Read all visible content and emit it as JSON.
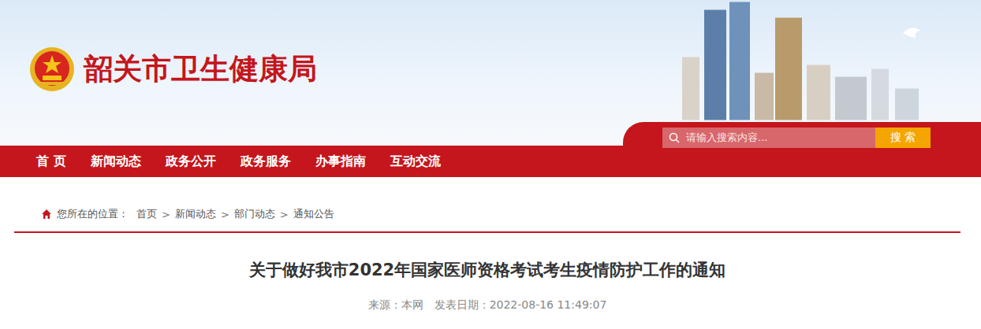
{
  "site": {
    "title": "韶关市卫生健康局"
  },
  "nav": [
    {
      "label": "首 页",
      "selected": false
    },
    {
      "label": "新闻动态",
      "selected": false
    },
    {
      "label": "政务公开",
      "selected": false
    },
    {
      "label": "政务服务",
      "selected": false
    },
    {
      "label": "办事指南",
      "selected": false
    },
    {
      "label": "互动交流",
      "selected": false
    }
  ],
  "search": {
    "placeholder": "请输入搜索内容...",
    "button": "搜 索"
  },
  "breadcrumb": {
    "prefix": "您所在的位置：",
    "separator": ">",
    "items": [
      "首页",
      "新闻动态",
      "部门动态",
      "通知公告"
    ]
  },
  "article": {
    "title": "关于做好我市2022年国家医师资格考试考生疫情防护工作的通知",
    "source_label": "来源：",
    "source": "本网",
    "date_label": "发表日期：",
    "date": "2022-08-16 11:49:07"
  }
}
